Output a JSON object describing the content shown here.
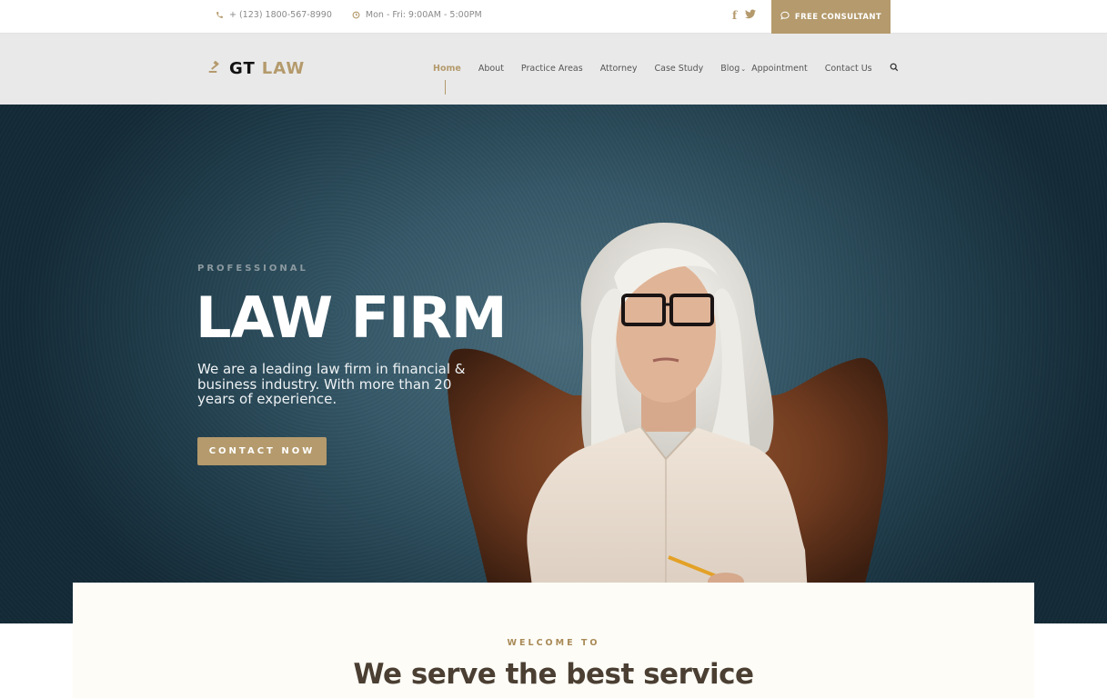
{
  "topbar": {
    "phone": "+ (123) 1800-567-8990",
    "hours": "Mon - Fri: 9:00AM - 5:00PM",
    "social": {
      "facebook": "f",
      "twitter": "twitter"
    },
    "cta_label": "FREE CONSULTANT"
  },
  "header": {
    "logo": {
      "part1": "GT",
      "part2": "LAW"
    },
    "nav": [
      {
        "label": "Home",
        "active": true
      },
      {
        "label": "About"
      },
      {
        "label": "Practice Areas"
      },
      {
        "label": "Attorney"
      },
      {
        "label": "Case Study"
      },
      {
        "label": "Blog",
        "has_dropdown": true
      },
      {
        "label": "Appointment"
      },
      {
        "label": "Contact Us"
      }
    ]
  },
  "hero": {
    "eyebrow": "PROFESSIONAL",
    "title": "LAW FIRM",
    "description": "We are a leading law firm in financial & business industry. With more than 20 years of experience.",
    "button_label": "CONTACT NOW"
  },
  "welcome": {
    "eyebrow": "WELCOME TO",
    "title": "We serve the best service"
  },
  "colors": {
    "accent": "#b49a6c",
    "hero_bg": "#2b4a59",
    "header_bg": "#e9e9e9",
    "card_bg": "#fdfcf7",
    "heading_dark": "#4a3f32"
  }
}
